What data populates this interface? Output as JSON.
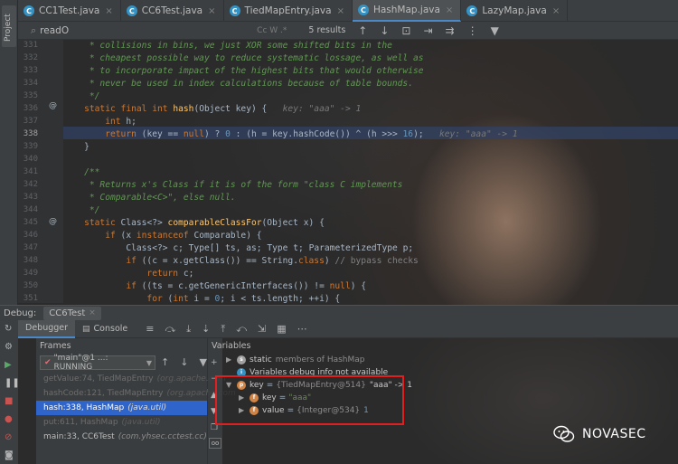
{
  "editor_tabs": [
    {
      "label": "CC1Test.java",
      "active": false
    },
    {
      "label": "CC6Test.java",
      "active": false
    },
    {
      "label": "TiedMapEntry.java",
      "active": false
    },
    {
      "label": "HashMap.java",
      "active": true
    },
    {
      "label": "LazyMap.java",
      "active": false
    }
  ],
  "project_label": "Project",
  "find": {
    "query": "readO",
    "options": "Cc  W  .*",
    "count": "5 results"
  },
  "code_lines": [
    {
      "num": "331",
      "text": "     * collisions in bins, we just XOR some shifted bits in the",
      "kind": "comment"
    },
    {
      "num": "332",
      "text": "     * cheapest possible way to reduce systematic lossage, as well as",
      "kind": "comment"
    },
    {
      "num": "333",
      "text": "     * to incorporate impact of the highest bits that would otherwise",
      "kind": "comment"
    },
    {
      "num": "334",
      "text": "     * never be used in index calculations because of table bounds.",
      "kind": "comment"
    },
    {
      "num": "335",
      "text": "     */",
      "kind": "comment"
    },
    {
      "num": "336",
      "text": "    static final int hash(Object key) {   key: \"aaa\" -> 1",
      "kind": "code"
    },
    {
      "num": "337",
      "text": "        int h;",
      "kind": "code"
    },
    {
      "num": "338",
      "text": "        return (key == null) ? 0 : (h = key.hashCode()) ^ (h >>> 16);   key: \"aaa\" -> 1",
      "kind": "current"
    },
    {
      "num": "339",
      "text": "    }",
      "kind": "code"
    },
    {
      "num": "340",
      "text": "",
      "kind": "code"
    },
    {
      "num": "341",
      "text": "    /**",
      "kind": "comment"
    },
    {
      "num": "342",
      "text": "     * Returns x's Class if it is of the form \"class C implements",
      "kind": "comment"
    },
    {
      "num": "343",
      "text": "     * Comparable<C>\", else null.",
      "kind": "comment"
    },
    {
      "num": "344",
      "text": "     */",
      "kind": "comment"
    },
    {
      "num": "345",
      "text": "    static Class<?> comparableClassFor(Object x) {",
      "kind": "code"
    },
    {
      "num": "346",
      "text": "        if (x instanceof Comparable) {",
      "kind": "code"
    },
    {
      "num": "347",
      "text": "            Class<?> c; Type[] ts, as; Type t; ParameterizedType p;",
      "kind": "code"
    },
    {
      "num": "348",
      "text": "            if ((c = x.getClass()) == String.class) // bypass checks",
      "kind": "code"
    },
    {
      "num": "349",
      "text": "                return c;",
      "kind": "code"
    },
    {
      "num": "350",
      "text": "            if ((ts = c.getGenericInterfaces()) != null) {",
      "kind": "code"
    },
    {
      "num": "351",
      "text": "                for (int i = 0; i < ts.length; ++i) {",
      "kind": "code"
    }
  ],
  "debug": {
    "label": "Debug:",
    "session_tab": "CC6Test",
    "tabs": [
      "Debugger",
      "Console"
    ],
    "frames_title": "Frames",
    "variables_title": "Variables",
    "thread": "\"main\"@1 ...: RUNNING",
    "frames": [
      {
        "method": "getValue:74, TiedMapEntry",
        "pkg": "(org.apache.com",
        "state": "dim"
      },
      {
        "method": "hashCode:121, TiedMapEntry",
        "pkg": "(org.apache.com",
        "state": "dim"
      },
      {
        "method": "hash:338, HashMap",
        "pkg": "(java.util)",
        "state": "selected"
      },
      {
        "method": "put:611, HashMap",
        "pkg": "(java.util)",
        "state": "dim"
      },
      {
        "method": "main:33, CC6Test",
        "pkg": "(com.yhsec.cctest.cc)",
        "state": "normal"
      }
    ],
    "variables": [
      {
        "name": "static",
        "suffix": "members of HashMap",
        "depth": 0,
        "expanded": false,
        "icon": "static"
      },
      {
        "name": "Variables debug info not available",
        "suffix": "",
        "depth": 0,
        "expanded": false,
        "icon": "info"
      },
      {
        "name": "key",
        "type": "{TiedMapEntry@514}",
        "value": "\"aaa\" -> 1",
        "depth": 0,
        "expanded": true,
        "icon": "param"
      },
      {
        "name": "key",
        "type": "",
        "value": "\"aaa\"",
        "depth": 1,
        "expanded": false,
        "icon": "field"
      },
      {
        "name": "value",
        "type": "{Integer@534}",
        "value": "1",
        "depth": 1,
        "expanded": false,
        "icon": "field"
      }
    ]
  },
  "watermark": "NOVASEC",
  "colors": {
    "selection": "#2f65ca",
    "current_line": "#324164",
    "highlight_box": "#e02020",
    "keyword": "#cc7832",
    "comment": "#629755"
  }
}
